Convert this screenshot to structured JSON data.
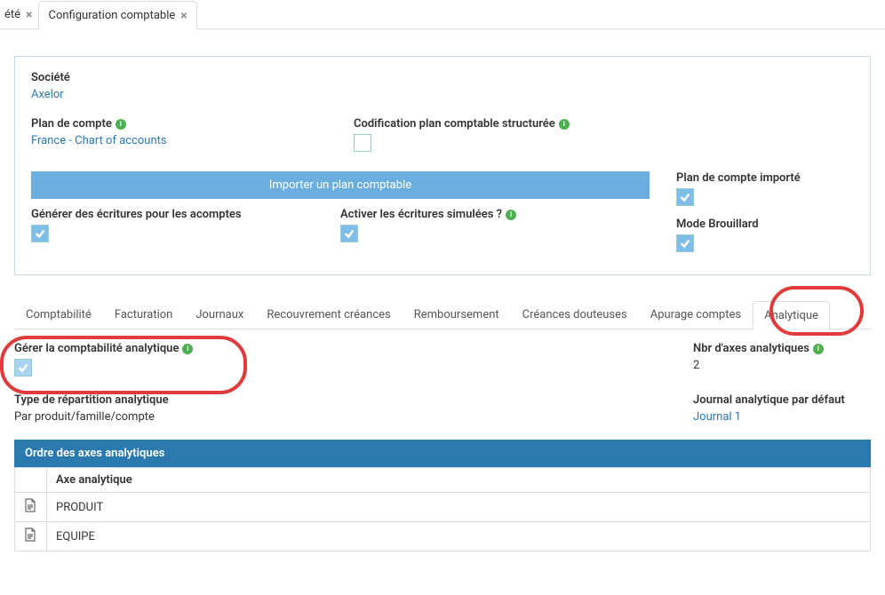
{
  "topTabs": {
    "partial": "été",
    "active": "Configuration comptable"
  },
  "panel": {
    "society_label": "Société",
    "society_value": "Axelor",
    "chart_label": "Plan de compte",
    "chart_value": "France - Chart of accounts",
    "codif_label": "Codification plan comptable structurée",
    "import_btn": "Importer un plan comptable",
    "gen_entries_label": "Générer des écritures pour les acomptes",
    "activate_sim_label": "Activer les écritures simulées ?",
    "imported_label": "Plan de compte importé",
    "draft_mode_label": "Mode Brouillard"
  },
  "subTabs": [
    "Comptabilité",
    "Facturation",
    "Journaux",
    "Recouvrement créances",
    "Remboursement",
    "Créances douteuses",
    "Apurage comptes",
    "Analytique"
  ],
  "analytic": {
    "manage_label": "Gérer la comptabilité analytique",
    "axes_count_label": "Nbr d'axes analytiques",
    "axes_count_value": "2",
    "repartition_label": "Type de répartition analytique",
    "repartition_value": "Par produit/famille/compte",
    "journal_label": "Journal analytique par défaut",
    "journal_value": "Journal 1"
  },
  "table": {
    "title": "Ordre des axes analytiques",
    "col": "Axe analytique",
    "rows": [
      "PRODUIT",
      "EQUIPE"
    ]
  }
}
